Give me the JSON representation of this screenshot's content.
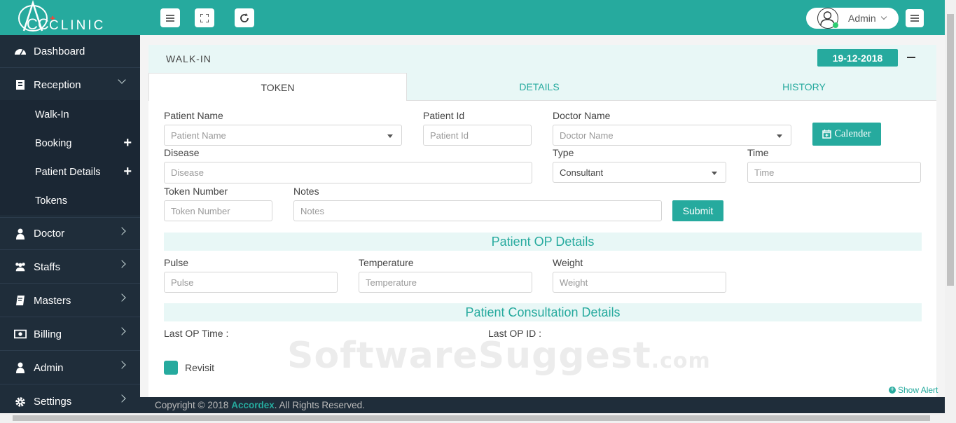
{
  "brand": {
    "logo_text": "CLINIC",
    "logo_prefix": "CC"
  },
  "sidebar": {
    "items": [
      {
        "label": "Dashboard",
        "icon": "dashboard-icon"
      },
      {
        "label": "Reception",
        "icon": "reception-icon",
        "expanded": true
      },
      {
        "label": "Doctor",
        "icon": "doctor-icon"
      },
      {
        "label": "Staffs",
        "icon": "staffs-icon"
      },
      {
        "label": "Masters",
        "icon": "masters-icon"
      },
      {
        "label": "Billing",
        "icon": "billing-icon"
      },
      {
        "label": "Admin",
        "icon": "admin-icon"
      },
      {
        "label": "Settings",
        "icon": "settings-icon"
      }
    ],
    "reception_sub": [
      {
        "label": "Walk-In"
      },
      {
        "label": "Booking",
        "plus": "+"
      },
      {
        "label": "Patient Details",
        "plus": "+"
      },
      {
        "label": "Tokens"
      }
    ]
  },
  "topbar": {
    "user_name": "Admin"
  },
  "panel": {
    "title": "WALK-IN",
    "date": "19-12-2018",
    "tabs": [
      {
        "label": "TOKEN",
        "active": true
      },
      {
        "label": "DETAILS"
      },
      {
        "label": "HISTORY"
      }
    ]
  },
  "form": {
    "patient_name": {
      "label": "Patient Name",
      "placeholder": "Patient Name"
    },
    "patient_id": {
      "label": "Patient Id",
      "placeholder": "Patient Id"
    },
    "doctor_name": {
      "label": "Doctor Name",
      "placeholder": "Doctor Name"
    },
    "calendar_button": "Calender",
    "disease": {
      "label": "Disease",
      "placeholder": "Disease"
    },
    "type": {
      "label": "Type",
      "value": "Consultant"
    },
    "time": {
      "label": "Time",
      "placeholder": "Time"
    },
    "token_number": {
      "label": "Token Number",
      "placeholder": "Token Number"
    },
    "notes": {
      "label": "Notes",
      "placeholder": "Notes"
    },
    "submit_button": "Submit"
  },
  "op_details": {
    "title": "Patient OP Details",
    "pulse": {
      "label": "Pulse",
      "placeholder": "Pulse"
    },
    "temperature": {
      "label": "Temperature",
      "placeholder": "Temperature"
    },
    "weight": {
      "label": "Weight",
      "placeholder": "Weight"
    }
  },
  "consultation": {
    "title": "Patient Consultation Details",
    "last_op_time": "Last OP Time :",
    "last_op_id": "Last OP ID :",
    "revisit": "Revisit"
  },
  "watermark": {
    "main": "SoftwareSuggest",
    "suffix": ".com"
  },
  "show_alert": "Show Alert",
  "footer": {
    "prefix": "Copyright © 2018",
    "brand": "Accordex",
    "suffix": ". All Rights Reserved."
  },
  "colors": {
    "accent": "#26aa9e",
    "sidebar": "#1f2d3a",
    "section_bg": "#e8f7f6"
  }
}
